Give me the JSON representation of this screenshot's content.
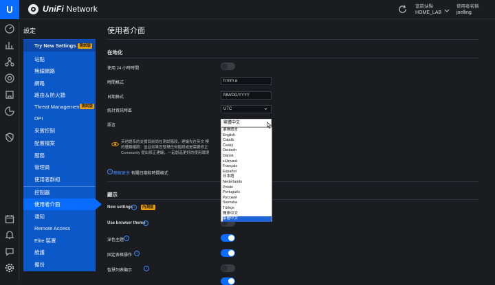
{
  "header": {
    "brand_bold": "UniFi",
    "brand_rest": " Network",
    "site_label": "當前站點",
    "site_value": "HOME_LAB",
    "user_label": "使用者名稱",
    "user_value": "joelling"
  },
  "sidebar": {
    "title": "設定",
    "try_label": "Try New Settings",
    "try_badge": "測試版",
    "items": [
      {
        "label": "站點"
      },
      {
        "label": "無線網路"
      },
      {
        "label": "網路"
      },
      {
        "label": "路由＆防火牆"
      },
      {
        "label": "Threat Management",
        "badge": "測試版"
      },
      {
        "label": "DPI"
      },
      {
        "label": "來賓控制"
      },
      {
        "label": "配置檔案"
      },
      {
        "label": "服務"
      },
      {
        "label": "管理員"
      },
      {
        "label": "使用者群組"
      },
      {
        "label": "控制器"
      },
      {
        "label": "使用者介面"
      },
      {
        "label": "通知"
      },
      {
        "label": "Remote Access"
      },
      {
        "label": "Elite 裝置"
      },
      {
        "label": "維護"
      },
      {
        "label": "備份"
      }
    ]
  },
  "main": {
    "title": "使用者介面",
    "localization": {
      "title": "在地化",
      "time24_label": "使用 24 小時時間",
      "time_format_label": "時間格式",
      "time_format_value": "h:mm a",
      "date_format_label": "日期格式",
      "date_format_value": "MM/DD/YYYY",
      "timezone_label": "統計資訊時區",
      "timezone_value": "UTC",
      "language_label": "語言",
      "language_value": "繁體中文",
      "notice_lines": [
        "英他語系的支援目前尚在測試階段，建議先在英文 模",
        "的獲翻權限：並且如果您發現任何錯誤或是需要修正",
        "Community 提出修正建議，一起創造更好的使用環境"
      ],
      "hint_link": "瞭解更多",
      "hint_text": " 有關日期和時間格式"
    },
    "display": {
      "title": "顯示",
      "new_settings_label": "New settings",
      "new_settings_badge": "內測版",
      "browser_theme_label": "Use browser theme",
      "dark_theme_label": "深色主題",
      "fixed_table_label": "固定表格操作",
      "smart_list_label": "智慧列表顯示"
    },
    "language_options": [
      "選擇語言",
      "English",
      "Català",
      "Český",
      "Deutsch",
      "Dansk",
      "ελληνικά",
      "Français",
      "Español",
      "日本語",
      "Nederlands",
      "Polski",
      "Português",
      "Русский",
      "Svenska",
      "Türkçe",
      "簡体中文",
      "繁體中文"
    ],
    "selected_language_index": 17
  },
  "toggles": {
    "time24": false,
    "browser_theme": false,
    "dark_theme": true,
    "fixed_table": true,
    "smart_list": false
  },
  "colors": {
    "accent": "#0a6cff",
    "nav_bg": "#0b58c9",
    "badge": "#f2a200"
  }
}
